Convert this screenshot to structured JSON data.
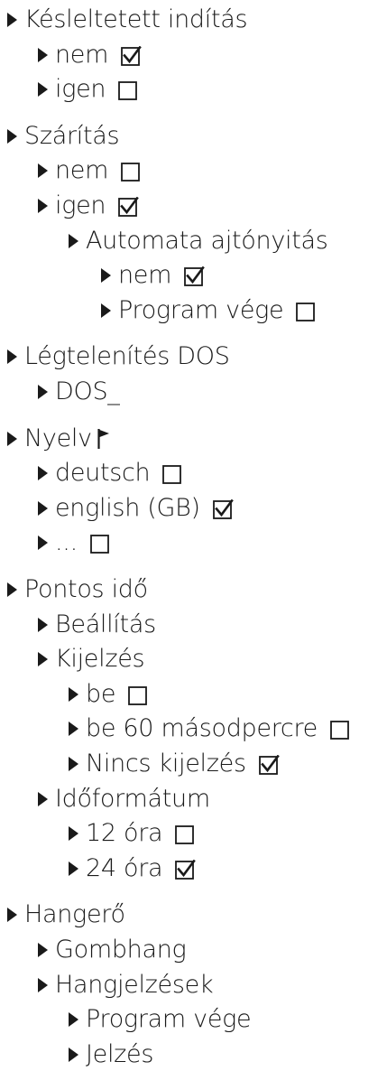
{
  "menu": [
    {
      "level": 0,
      "label": "Késleltetett indítás"
    },
    {
      "level": 1,
      "label": "nem",
      "box": "checked"
    },
    {
      "level": 1,
      "label": "igen",
      "box": "unchecked"
    },
    {
      "level": 0,
      "label": "Szárítás",
      "group_start": true
    },
    {
      "level": 1,
      "label": "nem",
      "box": "unchecked"
    },
    {
      "level": 1,
      "label": "igen",
      "box": "checked"
    },
    {
      "level": 2,
      "label": "Automata ajtónyitás"
    },
    {
      "level": 3,
      "label": "nem",
      "box": "checked"
    },
    {
      "level": 3,
      "label": "Program vége",
      "box": "unchecked"
    },
    {
      "level": 0,
      "label": "Légtelenítés DOS",
      "group_start": true
    },
    {
      "level": 1,
      "label": "DOS_"
    },
    {
      "level": 0,
      "label": "Nyelv",
      "icon": "flag-icon",
      "group_start": true
    },
    {
      "level": 1,
      "label": "deutsch",
      "box": "unchecked"
    },
    {
      "level": 1,
      "label": "english (GB)",
      "box": "checked"
    },
    {
      "level": 1,
      "label": "...",
      "box": "unchecked"
    },
    {
      "level": 0,
      "label": "Pontos idő",
      "group_start": true
    },
    {
      "level": 1,
      "label": "Beállítás"
    },
    {
      "level": 1,
      "label": "Kijelzés"
    },
    {
      "level": 2,
      "label": "be",
      "box": "unchecked"
    },
    {
      "level": 2,
      "label": "be 60 másodpercre",
      "box": "unchecked"
    },
    {
      "level": 2,
      "label": "Nincs kijelzés",
      "box": "checked"
    },
    {
      "level": 1,
      "label": "Időformátum"
    },
    {
      "level": 2,
      "label": "12 óra",
      "box": "unchecked"
    },
    {
      "level": 2,
      "label": "24 óra",
      "box": "checked"
    },
    {
      "level": 0,
      "label": "Hangerő",
      "group_start": true
    },
    {
      "level": 1,
      "label": "Gombhang"
    },
    {
      "level": 1,
      "label": "Hangjelzések"
    },
    {
      "level": 2,
      "label": "Program vége"
    },
    {
      "level": 2,
      "label": "Jelzés"
    }
  ]
}
